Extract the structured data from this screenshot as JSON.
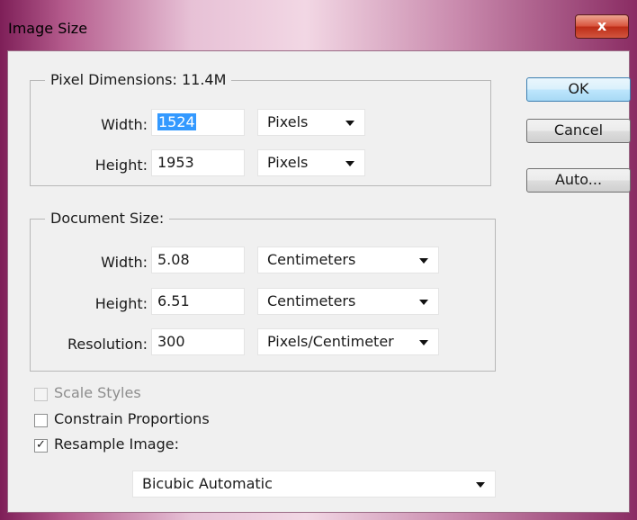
{
  "window": {
    "title": "Image Size",
    "close_glyph": "x"
  },
  "pixel_dimensions": {
    "legend": "Pixel Dimensions:  11.4M",
    "width_label": "Width:",
    "width_value": "1524",
    "width_unit": "Pixels",
    "height_label": "Height:",
    "height_value": "1953",
    "height_unit": "Pixels"
  },
  "document_size": {
    "legend": "Document Size:",
    "width_label": "Width:",
    "width_value": "5.08",
    "width_unit": "Centimeters",
    "height_label": "Height:",
    "height_value": "6.51",
    "height_unit": "Centimeters",
    "resolution_label": "Resolution:",
    "resolution_value": "300",
    "resolution_unit": "Pixels/Centimeter"
  },
  "buttons": {
    "ok": "OK",
    "cancel": "Cancel",
    "auto": "Auto..."
  },
  "options": {
    "scale_styles": {
      "label": "Scale Styles",
      "checked": false,
      "enabled": false
    },
    "constrain_proportions": {
      "label": "Constrain Proportions",
      "checked": false
    },
    "resample_image": {
      "label": "Resample Image:",
      "checked": true,
      "check_glyph": "✓"
    },
    "resample_method": "Bicubic Automatic"
  }
}
